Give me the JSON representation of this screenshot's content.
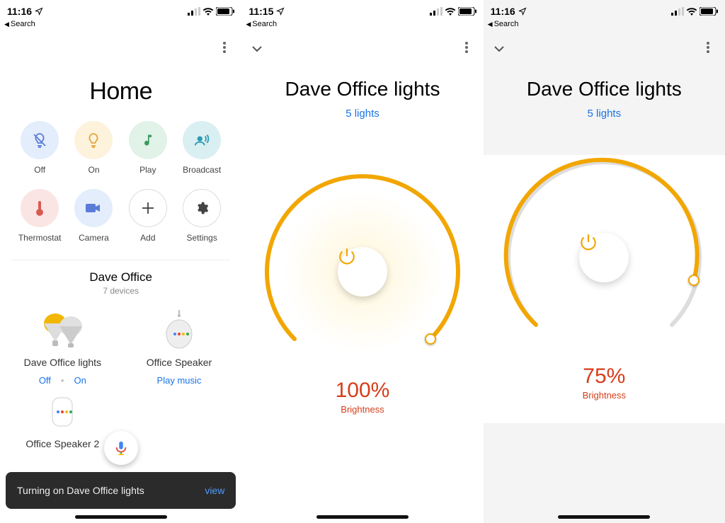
{
  "status": {
    "time1": "11:16",
    "time2": "11:15",
    "time3": "11:16",
    "back": "Search"
  },
  "home": {
    "title": "Home",
    "quick": [
      {
        "label": "Off"
      },
      {
        "label": "On"
      },
      {
        "label": "Play"
      },
      {
        "label": "Broadcast"
      },
      {
        "label": "Thermostat"
      },
      {
        "label": "Camera"
      },
      {
        "label": "Add"
      },
      {
        "label": "Settings"
      }
    ],
    "room": {
      "name": "Dave Office",
      "count": "7 devices"
    },
    "devices": [
      {
        "name": "Dave Office lights",
        "a1": "Off",
        "a2": "On"
      },
      {
        "name": "Office Speaker",
        "a1": "Play music"
      },
      {
        "name": "Office Speaker 2"
      }
    ],
    "toast": {
      "msg": "Turning on Dave Office lights",
      "action": "view"
    }
  },
  "light": {
    "title": "Dave Office lights",
    "sub": "5 lights",
    "pct1": "100%",
    "pct2": "75%",
    "label": "Brightness"
  }
}
